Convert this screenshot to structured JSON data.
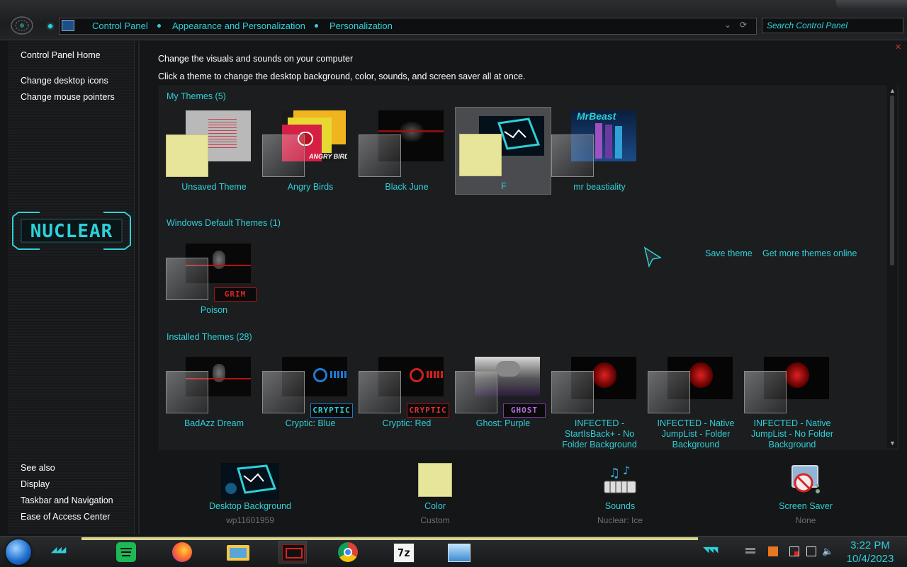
{
  "address_bar": {
    "crumbs": [
      "Control Panel",
      "Appearance and Personalization",
      "Personalization"
    ],
    "search_placeholder": "Search Control Panel"
  },
  "sidebar": {
    "home": "Control Panel Home",
    "links": [
      "Change desktop icons",
      "Change mouse pointers"
    ],
    "logo_text": "NUCLEAR",
    "see_also_title": "See also",
    "see_also": [
      "Display",
      "Taskbar and Navigation",
      "Ease of Access Center"
    ]
  },
  "main": {
    "heading": "Change the visuals and sounds on your computer",
    "subheading": "Click a theme to change the desktop background, color, sounds, and screen saver all at once.",
    "sections": {
      "my_themes": {
        "title": "My Themes (5)",
        "items": [
          "Unsaved Theme",
          "Angry Birds",
          "Black June",
          "F",
          "mr beastiality"
        ]
      },
      "default_themes": {
        "title": "Windows Default Themes (1)",
        "items": [
          "Poison"
        ]
      },
      "installed_themes": {
        "title": "Installed Themes (28)",
        "items": [
          "BadAzz Dream",
          "Cryptic: Blue",
          "Cryptic: Red",
          "Ghost: Purple",
          "INFECTED - StartIsBack+ - No Folder Background",
          "INFECTED - Native JumpList - Folder Background",
          "INFECTED - Native JumpList - No Folder Background"
        ]
      }
    },
    "thumb_text": {
      "angry_birds": "ANGRY BIRDS",
      "mr_beast": "MrBeast",
      "grim": "GRIM",
      "cryptic": "CRYPTIC",
      "ghost": "GHOST"
    },
    "save_theme": "Save theme",
    "get_more": "Get more themes online",
    "selected_theme": "F"
  },
  "settings": [
    {
      "title": "Desktop Background",
      "value": "wp11601959",
      "icon": "desktop-background-icon"
    },
    {
      "title": "Color",
      "value": "Custom",
      "icon": "color-swatch-icon"
    },
    {
      "title": "Sounds",
      "value": "Nuclear: Ice",
      "icon": "sounds-icon"
    },
    {
      "title": "Screen Saver",
      "value": "None",
      "icon": "screen-saver-icon"
    }
  ],
  "taskbar": {
    "apps": [
      "spotify-icon",
      "firefox-icon",
      "file-explorer-icon",
      "personalization-icon",
      "chrome-icon",
      "7zip-icon",
      "image-viewer-icon"
    ],
    "seven_zip_label": "7z",
    "time": "3:22 PM",
    "date": "10/4/2023"
  },
  "colors": {
    "accent": "#2fd0d8",
    "background": "#151617",
    "swatch": "#e7e59a"
  }
}
